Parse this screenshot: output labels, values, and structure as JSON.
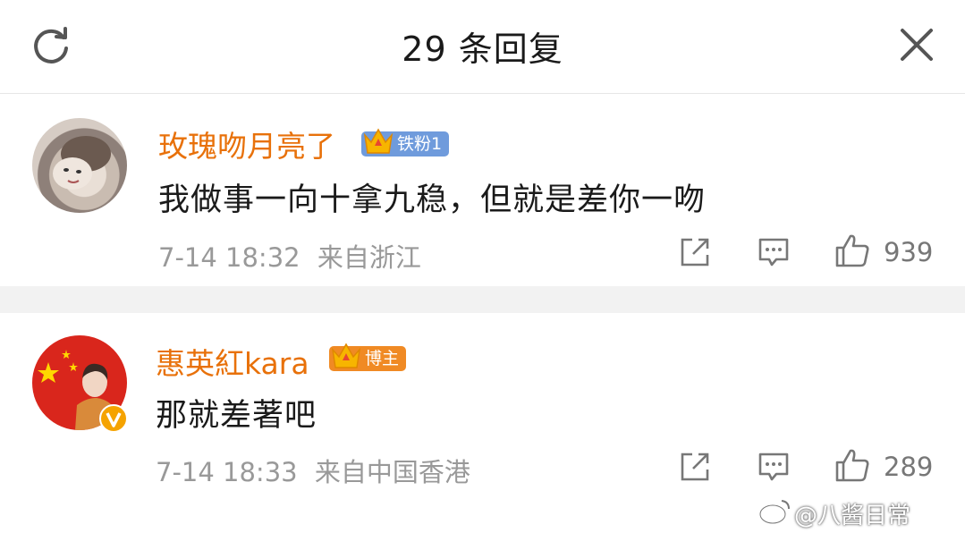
{
  "header": {
    "title": "29 条回复",
    "refresh_icon": "refresh-icon",
    "close_icon": "close-icon"
  },
  "comments": [
    {
      "username": "玫瑰吻月亮了",
      "badge": "铁粉1",
      "text": "我做事一向十拿九稳，但就是差你一吻",
      "time": "7-14 18:32",
      "location": "来自浙江",
      "likes": "939"
    },
    {
      "username": "惠英紅kara",
      "badge": "博主",
      "text": "那就差著吧",
      "time": "7-14 18:33",
      "location": "来自中国香港",
      "likes": "289"
    }
  ],
  "watermark": "@八酱日常",
  "colors": {
    "username": "#e8710a",
    "fan_badge": "#6f9bdc",
    "host_badge": "#f08a24",
    "meta": "#999999"
  }
}
